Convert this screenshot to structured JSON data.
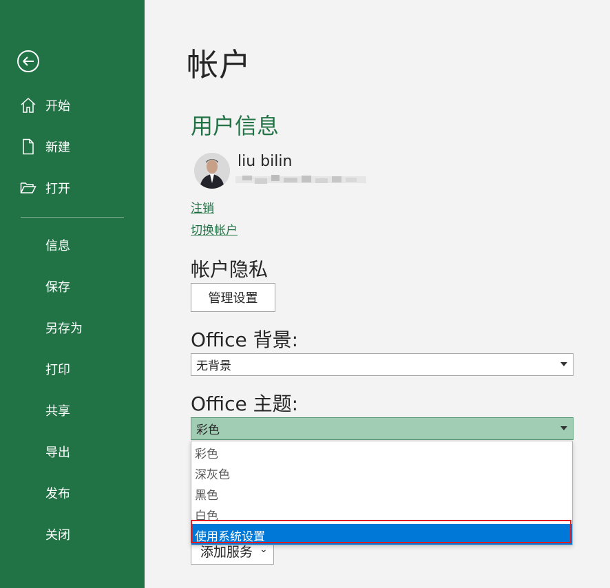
{
  "sidebar": {
    "items": [
      {
        "label": "开始",
        "icon": "home-icon"
      },
      {
        "label": "新建",
        "icon": "new-document-icon"
      },
      {
        "label": "打开",
        "icon": "folder-open-icon"
      },
      {
        "label": "信息"
      },
      {
        "label": "保存"
      },
      {
        "label": "另存为"
      },
      {
        "label": "打印"
      },
      {
        "label": "共享"
      },
      {
        "label": "导出"
      },
      {
        "label": "发布"
      },
      {
        "label": "关闭"
      }
    ],
    "back_icon": "back-arrow-icon"
  },
  "main": {
    "title": "帐户",
    "user_info": {
      "heading": "用户信息",
      "name": "liu bilin",
      "sign_out": "注销",
      "switch_account": "切换帐户"
    },
    "privacy": {
      "heading": "帐户隐私",
      "manage_button": "管理设置"
    },
    "background": {
      "heading": "Office 背景:",
      "value": "无背景"
    },
    "theme": {
      "heading": "Office 主题:",
      "value": "彩色",
      "options": [
        "彩色",
        "深灰色",
        "黑色",
        "白色",
        "使用系统设置"
      ],
      "highlighted_option": "使用系统设置"
    },
    "services": {
      "add_button": "添加服务",
      "chevron": "⌄"
    }
  },
  "colors": {
    "sidebar_bg": "#217346",
    "accent_green": "#217346",
    "selected_blue": "#0078d7",
    "highlight_red": "#e01b24"
  }
}
